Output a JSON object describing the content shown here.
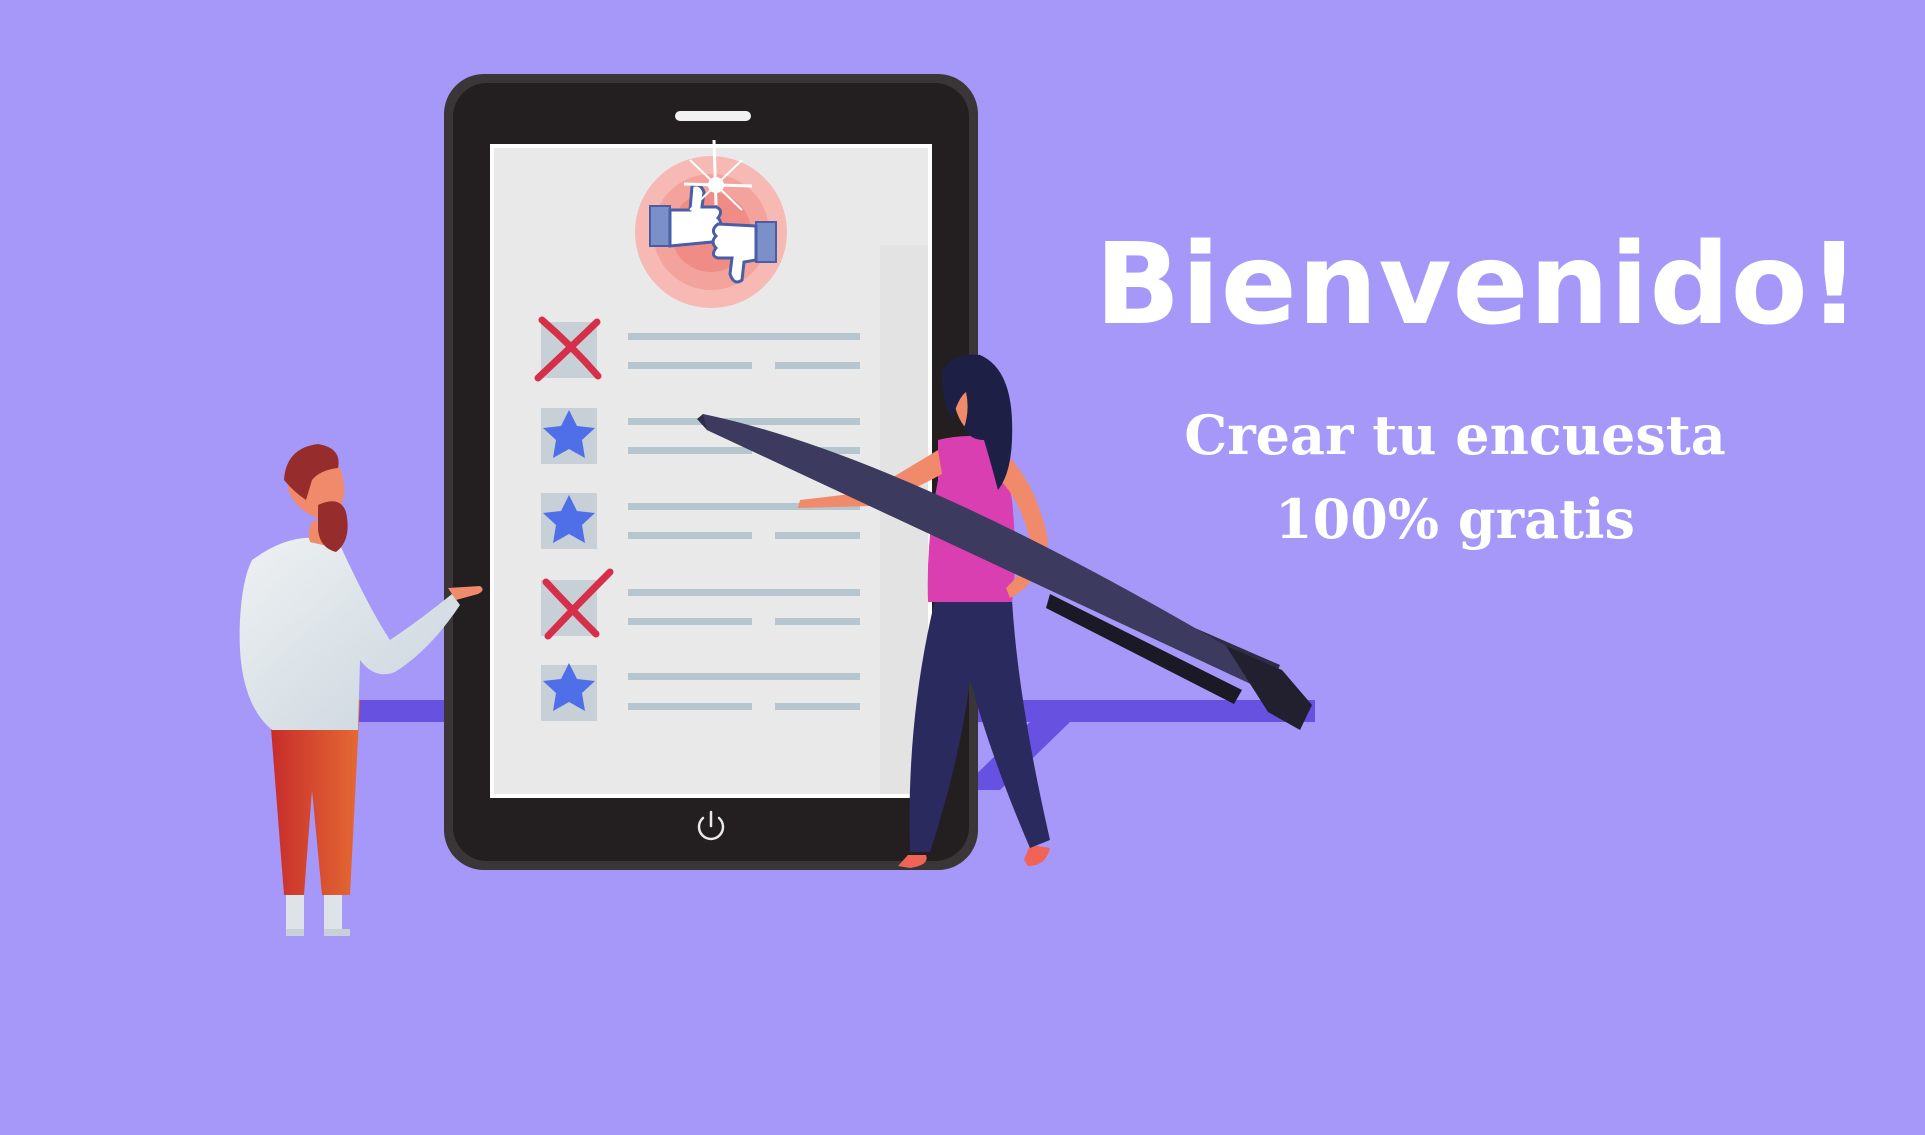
{
  "welcome": {
    "title": "Bienvenido!",
    "subtitle_line1": "Crear tu encuesta",
    "subtitle_line2": "100% gratis"
  },
  "illustration": {
    "icons": [
      "thumbs-up-icon",
      "thumbs-down-icon",
      "cross-mark-icon",
      "star-icon",
      "power-icon",
      "pen-icon"
    ],
    "survey_marks": [
      "cross",
      "star",
      "star",
      "cross",
      "star"
    ]
  },
  "colors": {
    "background": "#a698f9",
    "floor": "#6651e0",
    "tablet_frame": "#231f20",
    "screen": "#e9e9ea",
    "cross": "#d52f4a",
    "star": "#4f6fe8",
    "text": "#ffffff"
  }
}
